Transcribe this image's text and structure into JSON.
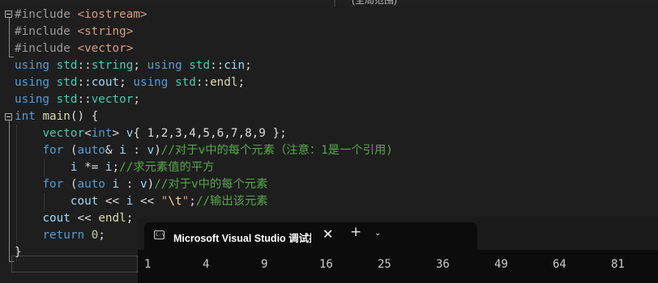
{
  "topbar": {
    "scope_label": "(全局范围)"
  },
  "code_lines": [
    [
      [
        "pp",
        "#include "
      ],
      [
        "inc",
        "<iostream>"
      ]
    ],
    [
      [
        "pp",
        "#include "
      ],
      [
        "inc",
        "<string>"
      ]
    ],
    [
      [
        "pp",
        "#include "
      ],
      [
        "inc",
        "<vector>"
      ]
    ],
    [
      [
        "kw",
        "using "
      ],
      [
        "ty",
        "std"
      ],
      [
        "pl",
        "::"
      ],
      [
        "ty",
        "string"
      ],
      [
        "pl",
        "; "
      ],
      [
        "kw",
        "using "
      ],
      [
        "ty",
        "std"
      ],
      [
        "pl",
        "::"
      ],
      [
        "var",
        "cin"
      ],
      [
        "pl",
        ";"
      ]
    ],
    [
      [
        "kw",
        "using "
      ],
      [
        "ty",
        "std"
      ],
      [
        "pl",
        "::"
      ],
      [
        "var",
        "cout"
      ],
      [
        "pl",
        "; "
      ],
      [
        "kw",
        "using "
      ],
      [
        "ty",
        "std"
      ],
      [
        "pl",
        "::"
      ],
      [
        "fn",
        "endl"
      ],
      [
        "pl",
        ";"
      ]
    ],
    [
      [
        "kw",
        "using "
      ],
      [
        "ty",
        "std"
      ],
      [
        "pl",
        "::"
      ],
      [
        "ty",
        "vector"
      ],
      [
        "pl",
        ";"
      ]
    ],
    [
      [
        "kw",
        "int "
      ],
      [
        "fn",
        "main"
      ],
      [
        "pl",
        "() {"
      ]
    ],
    [
      [
        "pl",
        "    "
      ],
      [
        "ty",
        "vector"
      ],
      [
        "pl",
        "<"
      ],
      [
        "kw",
        "int"
      ],
      [
        "pl",
        "> "
      ],
      [
        "var",
        "v"
      ],
      [
        "pl",
        "{ 1,2,3,4,5,6,7,8,9 };"
      ]
    ],
    [
      [
        "pl",
        "    "
      ],
      [
        "kw",
        "for "
      ],
      [
        "pl",
        "("
      ],
      [
        "kw",
        "auto"
      ],
      [
        "pl",
        "& "
      ],
      [
        "var",
        "i"
      ],
      [
        "pl",
        " : "
      ],
      [
        "var",
        "v"
      ],
      [
        "pl",
        ")"
      ],
      [
        "cm",
        "//对于v中的每个元素（注意：1是一个引用)"
      ]
    ],
    [
      [
        "pl",
        "        "
      ],
      [
        "var",
        "i"
      ],
      [
        "pl",
        " *= "
      ],
      [
        "var",
        "i"
      ],
      [
        "pl",
        ";"
      ],
      [
        "cm",
        "//求元素值的平方"
      ]
    ],
    [
      [
        "pl",
        "    "
      ],
      [
        "kw",
        "for "
      ],
      [
        "pl",
        "("
      ],
      [
        "kw",
        "auto "
      ],
      [
        "var",
        "i"
      ],
      [
        "pl",
        " : "
      ],
      [
        "var",
        "v"
      ],
      [
        "pl",
        ")"
      ],
      [
        "cm",
        "//对于v中的每个元素"
      ]
    ],
    [
      [
        "pl",
        "        "
      ],
      [
        "var",
        "cout"
      ],
      [
        "pl",
        " << "
      ],
      [
        "var",
        "i"
      ],
      [
        "pl",
        " << "
      ],
      [
        "str",
        "\""
      ],
      [
        "esc",
        "\\t"
      ],
      [
        "str",
        "\""
      ],
      [
        "pl",
        ";"
      ],
      [
        "cm",
        "//输出该元素"
      ]
    ],
    [
      [
        "pl",
        "    "
      ],
      [
        "var",
        "cout"
      ],
      [
        "pl",
        " << "
      ],
      [
        "fn",
        "endl"
      ],
      [
        "pl",
        ";"
      ]
    ],
    [
      [
        "pl",
        "    "
      ],
      [
        "kw",
        "return "
      ],
      [
        "num",
        "0"
      ],
      [
        "pl",
        ";"
      ]
    ],
    [
      [
        "pl",
        "}"
      ]
    ]
  ],
  "terminal": {
    "tab_title": "Microsoft Visual Studio 调试控制台",
    "tab_icon_text": "C:\\",
    "close_glyph": "✕",
    "new_tab_glyph": "+",
    "menu_glyph": "⌄",
    "output": [
      "1",
      "4",
      "9",
      "16",
      "25",
      "36",
      "49",
      "64",
      "81"
    ]
  }
}
